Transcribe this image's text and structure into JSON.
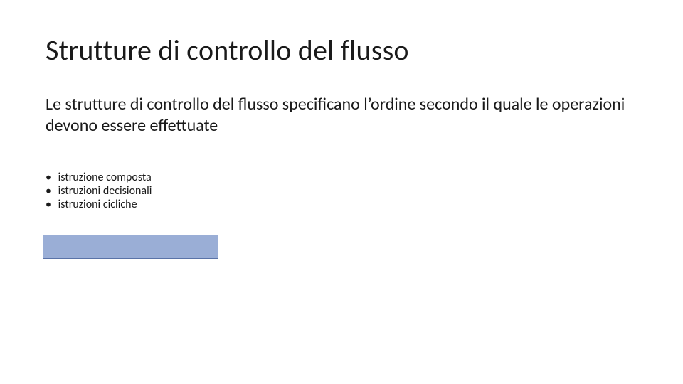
{
  "slide": {
    "title": "Strutture di controllo del flusso",
    "body": "Le strutture di controllo del flusso specificano l’ordine secondo il quale le operazioni devono essere effettuate",
    "bullets": [
      "istruzione composta",
      "istruzioni decisionali",
      "istruzioni cicliche"
    ]
  },
  "highlight": {
    "color_fill": "#9aaed6",
    "color_border": "#5a73a8"
  }
}
